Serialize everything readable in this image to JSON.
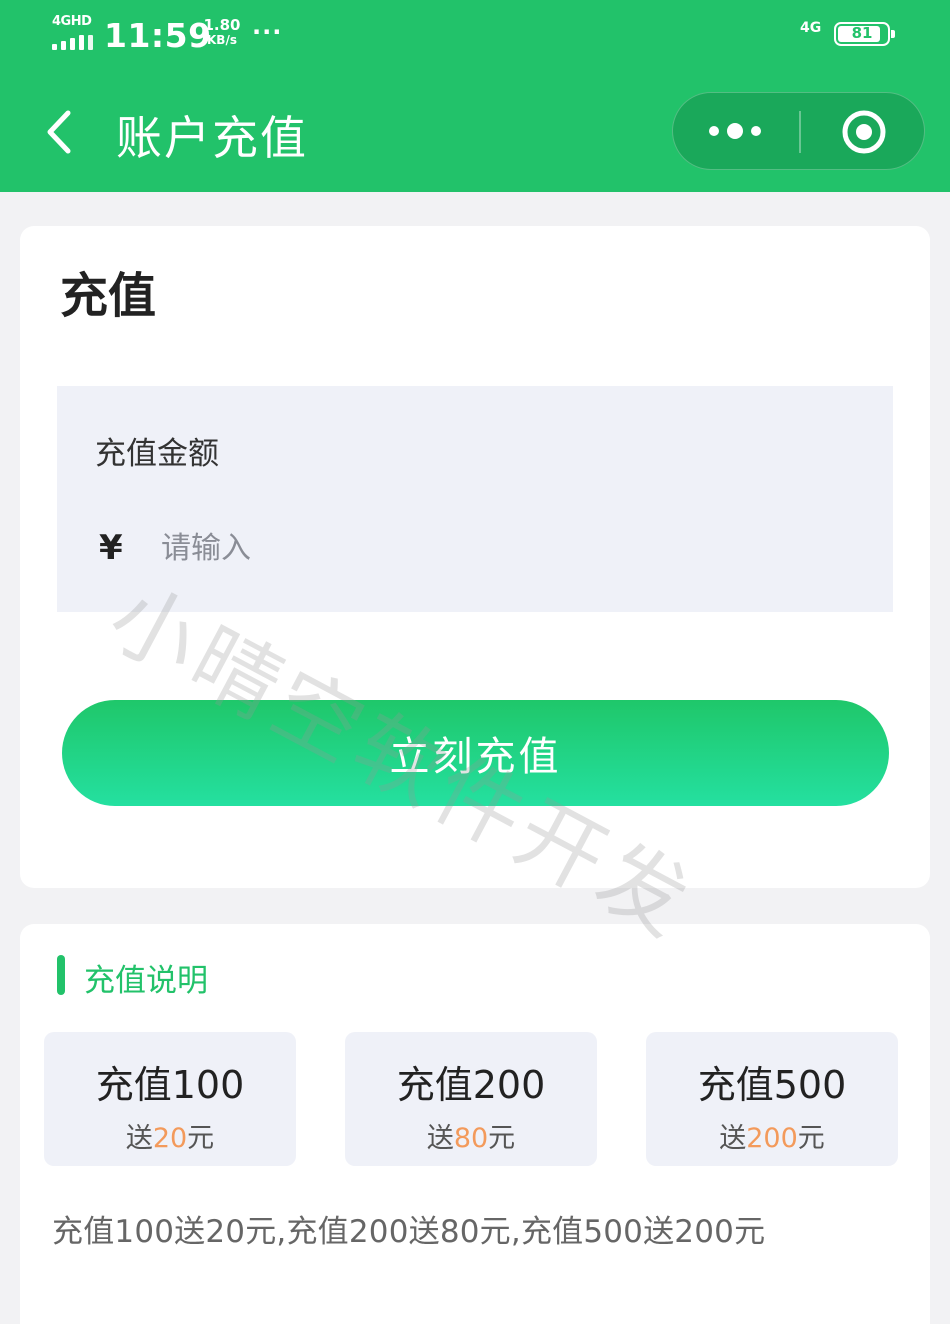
{
  "status_bar": {
    "signal_label": "4GHD",
    "time": "11:59",
    "net_speed_value": "1.80",
    "net_speed_unit": "KB/s",
    "more_dots": "···",
    "network_type": "4G",
    "battery": "81"
  },
  "nav": {
    "title": "账户充值"
  },
  "recharge_card": {
    "title": "充值",
    "amount_label": "充值金额",
    "currency_symbol": "¥",
    "amount_placeholder": "请输入",
    "amount_value": "",
    "submit_label": "立刻充值"
  },
  "info_card": {
    "section_title": "充值说明",
    "packages": [
      {
        "title": "充值100",
        "bonus_prefix": "送",
        "bonus_amount": "20",
        "bonus_suffix": "元"
      },
      {
        "title": "充值200",
        "bonus_prefix": "送",
        "bonus_amount": "80",
        "bonus_suffix": "元"
      },
      {
        "title": "充值500",
        "bonus_prefix": "送",
        "bonus_amount": "200",
        "bonus_suffix": "元"
      }
    ],
    "note": "充值100送20元,充值200送80元,充值500送200元"
  },
  "watermark": "小晴空软件开发",
  "colors": {
    "brand_green": "#22c26a",
    "bonus_orange": "#f39a5b",
    "panel_bg": "#eff1f8"
  },
  "icons": [
    "back-arrow-icon",
    "more-dots-icon",
    "close-target-icon"
  ]
}
